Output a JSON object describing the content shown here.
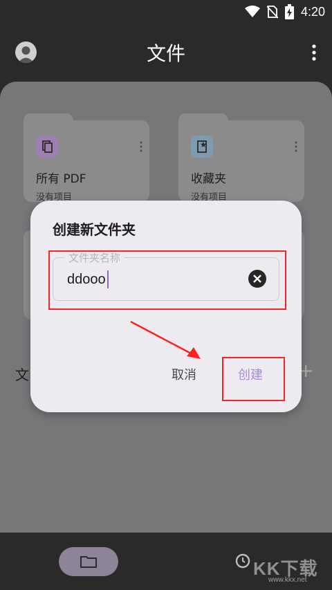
{
  "status_bar": {
    "time": "4:20"
  },
  "app_bar": {
    "title": "文件"
  },
  "cards": [
    {
      "title": "所有 PDF",
      "subtitle": "没有项目",
      "icon": "pdf-files-icon",
      "icon_color": "#b08cc3"
    },
    {
      "title": "收藏夹",
      "subtitle": "没有项目",
      "icon": "favorite-doc-icon",
      "icon_color": "#8fb0c6"
    }
  ],
  "section": {
    "label": "文"
  },
  "dialog": {
    "title": "创建新文件夹",
    "field_label": "文件夹名称",
    "field_value": "ddooo",
    "cancel_label": "取消",
    "create_label": "创建"
  },
  "watermark": {
    "text": "KK下载",
    "sub": "www.kkx.net"
  },
  "colors": {
    "accent": "#a98bd3",
    "highlight": "#ff1f1f",
    "caret": "#8c67c9"
  }
}
